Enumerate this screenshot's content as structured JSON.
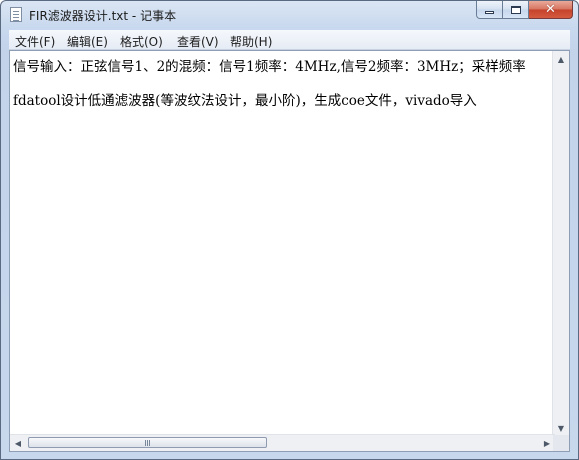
{
  "window": {
    "title": "FIR滤波器设计.txt - 记事本",
    "close_glyph": "✕"
  },
  "menu": [
    {
      "label": "文件(F)"
    },
    {
      "label": "编辑(E)"
    },
    {
      "label": "格式(O)"
    },
    {
      "label": "查看(V)"
    },
    {
      "label": "帮助(H)"
    }
  ],
  "document": {
    "lines": [
      "信号输入：正弦信号1、2的混频：信号1频率：4MHz,信号2频率：3MHz；采样频率",
      "fdatool设计低通滤波器(等波纹法设计，最小阶)，生成coe文件，vivado导入"
    ]
  },
  "scrollbars": {
    "arrow_up": "▲",
    "arrow_down": "▼",
    "arrow_left": "◀",
    "arrow_right": "▶",
    "horizontal_thumb_fraction": 0.47
  }
}
